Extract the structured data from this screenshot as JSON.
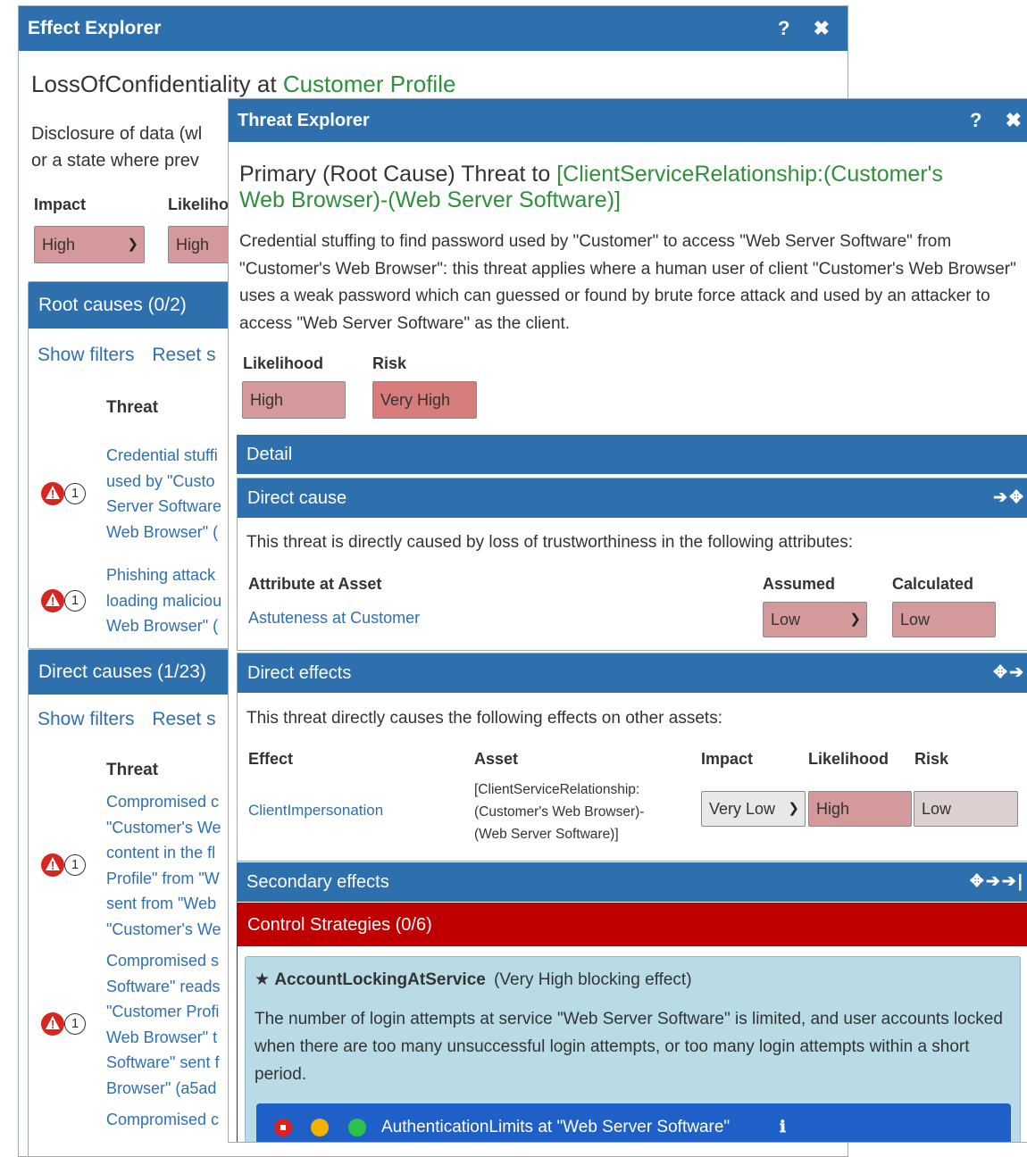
{
  "effect": {
    "title": "Effect Explorer",
    "tools": "? ✖",
    "heading_prefix": "LossOfConfidentiality at ",
    "heading_asset": "Customer Profile",
    "desc_line1": "Disclosure of data (wl",
    "desc_line2": "or a state where prev",
    "impact_label": "Impact",
    "likelihood_label": "Likeliho",
    "impact_value": "High",
    "likelihood_value": "High",
    "root_title": "Root causes (0/2)",
    "show_filters": "Show filters",
    "reset": "Reset s",
    "threat_col": "Threat",
    "root_items": [
      {
        "lines": [
          "Credential stuffi",
          "used by \"Custo",
          "Server Software",
          "Web Browser\" ("
        ]
      },
      {
        "lines": [
          "Phishing attack",
          "loading maliciou",
          "Web Browser\" ("
        ]
      }
    ],
    "direct_title": "Direct causes (1/23)",
    "show_filters2": "Show filters",
    "reset2": "Reset s",
    "threat_col2": "Threat",
    "direct_items": [
      {
        "lines": [
          "Compromised c",
          "\"Customer's We",
          "content in the fl",
          "Profile\" from \"W",
          "sent from \"Web",
          "\"Customer's We"
        ]
      },
      {
        "lines": [
          "Compromised s",
          "Software\" reads",
          "\"Customer Profi",
          "Web Browser\" t",
          "Software\" sent f",
          "Browser\" (a5ad"
        ]
      },
      {
        "lines": [
          "Compromised c"
        ]
      }
    ],
    "badge_num": "1",
    "badge_mark": "!"
  },
  "threat": {
    "title": "Threat Explorer",
    "tools": "? ✖",
    "heading_prefix": "Primary (Root Cause) Threat to ",
    "heading_asset_l1": "[ClientServiceRelationship:(Customer's",
    "heading_asset_l2": "Web Browser)-(Web Server Software)]",
    "description": "Credential stuffing to find password used by \"Customer\" to access \"Web Server Software\" from \"Customer's Web Browser\": this threat applies where a human user of client \"Customer's Web Browser\" uses a weak password which can guessed or found by brute force attack and used by an attacker to access \"Web Server Software\" as the client.",
    "likelihood_label": "Likelihood",
    "risk_label": "Risk",
    "likelihood_value": "High",
    "risk_value": "Very High",
    "detail": "Detail",
    "direct_cause_title": "Direct cause",
    "direct_cause_actions": "➔✥",
    "direct_cause_text": "This threat is directly caused by loss of trustworthiness in the following attributes:",
    "col_attr": "Attribute at Asset",
    "col_assumed": "Assumed",
    "col_calculated": "Calculated",
    "attr_link": "Astuteness at Customer",
    "assumed_value": "Low",
    "calculated_value": "Low",
    "direct_effects_title": "Direct effects",
    "direct_effects_actions": "✥➔",
    "direct_effects_text": "This threat directly causes the following effects on other assets:",
    "col_effect": "Effect",
    "col_asset": "Asset",
    "col_impact": "Impact",
    "col_likelihood": "Likelihood",
    "col_risk": "Risk",
    "effect_link": "ClientImpersonation",
    "effect_asset_l1": "[ClientServiceRelationship:",
    "effect_asset_l2": "(Customer's Web Browser)-",
    "effect_asset_l3": "(Web Server Software)]",
    "effect_impact": "Very Low",
    "effect_likelihood": "High",
    "effect_risk": "Low",
    "secondary_title": "Secondary effects",
    "secondary_actions": "✥➔➔|",
    "control_title": "Control Strategies (0/6)",
    "cs_name": "AccountLockingAtService",
    "cs_effect": "(Very High blocking effect)",
    "cs_desc": "The number of login attempts at service \"Web Server Software\" is limited, and user accounts locked when there are too many unsuccessful login attempts, or too many login attempts within a short period.",
    "control_name": "AuthenticationLimits at \"Web Server Software\"",
    "colors": {
      "red_dot": "#e02020",
      "amber_dot": "#f0b400",
      "green_dot": "#2ec24a",
      "control_bar": "#1f5fc8",
      "strategies_header": "#c00000",
      "cs_box": "#b8dbe6"
    }
  }
}
